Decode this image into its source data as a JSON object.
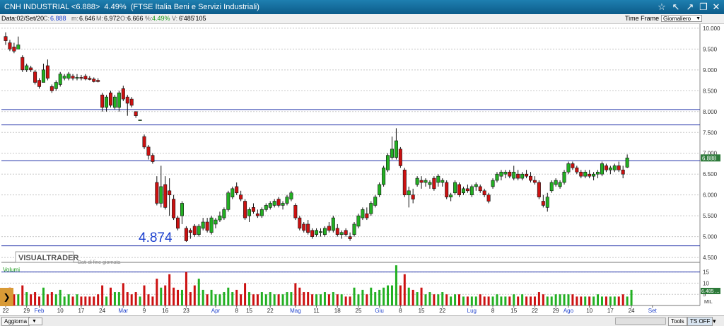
{
  "window": {
    "title": "CNH INDUSTRIAL <6.888>  4.49%  (FTSE Italia Beni e Servizi Industriali)",
    "icons": [
      "star-icon",
      "back-icon",
      "forward-icon",
      "restore-icon",
      "close-icon"
    ]
  },
  "info": {
    "date": "Data:02/Set/20",
    "close_label": "C:",
    "close": "6.888",
    "min_label": "m:",
    "min": "6.646",
    "max_label": "M:",
    "max": "6.972",
    "open_label": "O:",
    "open": "6.666",
    "pct_label": "%:",
    "pct": "4.49%",
    "vol_label": "V:",
    "vol": "6'485'105",
    "timeframe_label": "Time Frame",
    "timeframe_value": "Giornaliero"
  },
  "chart_data": {
    "type": "candlestick",
    "ylim": [
      4.4,
      10.1
    ],
    "yticks": [
      "10.000",
      "9.500",
      "9.000",
      "8.500",
      "8.000",
      "7.500",
      "7.000",
      "6.500",
      "6.000",
      "5.500",
      "5.000",
      "4.500"
    ],
    "ytick_values": [
      10.0,
      9.5,
      9.0,
      8.5,
      8.0,
      7.5,
      7.0,
      6.5,
      6.0,
      5.5,
      5.0,
      4.5
    ],
    "hlines": [
      8.05,
      7.68,
      6.82,
      4.78
    ],
    "last_price": "6.888",
    "last_price_value": 6.888,
    "low_label": "4.874",
    "low_label_value": 4.874,
    "logo": "VISUALTRADER",
    "note": "Dati di fine giornata",
    "volume_title": "Volumi",
    "volume_ylim": [
      0,
      19
    ],
    "volume_ticks": [
      "15",
      "10",
      "5"
    ],
    "volume_tick_values": [
      15,
      10,
      5
    ],
    "volume_hline": 15,
    "volume_badge": "6.485 ...",
    "volume_unit": "MIL",
    "colors": {
      "up": "#22b022",
      "down": "#cc1111",
      "hline": "#2233aa",
      "grid": "#c8c8c8"
    },
    "xticks": [
      {
        "i": 0,
        "label": "22",
        "month": false
      },
      {
        "i": 5,
        "label": "29",
        "month": false
      },
      {
        "i": 8,
        "label": "Feb",
        "month": true
      },
      {
        "i": 13,
        "label": "10",
        "month": false
      },
      {
        "i": 18,
        "label": "17",
        "month": false
      },
      {
        "i": 23,
        "label": "24",
        "month": false
      },
      {
        "i": 28,
        "label": "Mar",
        "month": true
      },
      {
        "i": 33,
        "label": "9",
        "month": false
      },
      {
        "i": 38,
        "label": "16",
        "month": false
      },
      {
        "i": 43,
        "label": "23",
        "month": false
      },
      {
        "i": 50,
        "label": "Apr",
        "month": true
      },
      {
        "i": 55,
        "label": "8",
        "month": false
      },
      {
        "i": 58,
        "label": "15",
        "month": false
      },
      {
        "i": 63,
        "label": "22",
        "month": false
      },
      {
        "i": 69,
        "label": "Mag",
        "month": true
      },
      {
        "i": 74,
        "label": "11",
        "month": false
      },
      {
        "i": 79,
        "label": "18",
        "month": false
      },
      {
        "i": 84,
        "label": "25",
        "month": false
      },
      {
        "i": 89,
        "label": "Giu",
        "month": true
      },
      {
        "i": 94,
        "label": "8",
        "month": false
      },
      {
        "i": 99,
        "label": "15",
        "month": false
      },
      {
        "i": 104,
        "label": "22",
        "month": false
      },
      {
        "i": 111,
        "label": "Lug",
        "month": true
      },
      {
        "i": 116,
        "label": "8",
        "month": false
      },
      {
        "i": 121,
        "label": "15",
        "month": false
      },
      {
        "i": 126,
        "label": "22",
        "month": false
      },
      {
        "i": 131,
        "label": "29",
        "month": false
      },
      {
        "i": 134,
        "label": "Ago",
        "month": true
      },
      {
        "i": 139,
        "label": "10",
        "month": false
      },
      {
        "i": 144,
        "label": "17",
        "month": false
      },
      {
        "i": 149,
        "label": "24",
        "month": false
      },
      {
        "i": 154,
        "label": "Set",
        "month": true
      }
    ],
    "candles": [
      [
        9.8,
        9.9,
        9.6,
        9.7
      ],
      [
        9.65,
        9.72,
        9.45,
        9.5
      ],
      [
        9.55,
        9.65,
        9.4,
        9.45
      ],
      [
        9.5,
        9.8,
        9.5,
        9.6
      ],
      [
        9.3,
        9.35,
        8.95,
        9.0
      ],
      [
        9.0,
        9.15,
        8.95,
        9.1
      ],
      [
        9.05,
        9.1,
        8.95,
        9.0
      ],
      [
        8.95,
        9.0,
        8.65,
        8.7
      ],
      [
        8.75,
        8.8,
        8.55,
        8.6
      ],
      [
        8.7,
        9.15,
        8.7,
        9.0
      ],
      [
        9.1,
        9.25,
        8.75,
        8.8
      ],
      [
        8.6,
        8.65,
        8.45,
        8.5
      ],
      [
        8.55,
        8.75,
        8.5,
        8.7
      ],
      [
        8.65,
        8.95,
        8.6,
        8.9
      ],
      [
        8.8,
        8.9,
        8.75,
        8.85
      ],
      [
        8.8,
        8.95,
        8.75,
        8.9
      ],
      [
        8.85,
        8.9,
        8.75,
        8.8
      ],
      [
        8.8,
        8.9,
        8.75,
        8.82
      ],
      [
        8.82,
        8.88,
        8.75,
        8.8
      ],
      [
        8.85,
        8.9,
        8.75,
        8.78
      ],
      [
        8.8,
        8.85,
        8.75,
        8.77
      ],
      [
        8.78,
        8.82,
        8.7,
        8.72
      ],
      [
        8.75,
        8.8,
        8.7,
        8.72
      ],
      [
        8.4,
        8.45,
        8.0,
        8.1
      ],
      [
        8.1,
        8.4,
        8.0,
        8.35
      ],
      [
        8.45,
        8.5,
        8.1,
        8.15
      ],
      [
        8.1,
        8.4,
        8.05,
        8.35
      ],
      [
        8.1,
        8.5,
        8.0,
        8.45
      ],
      [
        8.55,
        8.62,
        8.25,
        8.3
      ],
      [
        8.35,
        8.4,
        7.9,
        8.2
      ],
      [
        8.3,
        8.35,
        8.1,
        8.15
      ],
      [
        8.0,
        8.0,
        7.85,
        7.9
      ],
      [
        7.8,
        7.8,
        7.8,
        7.8
      ],
      [
        7.4,
        7.45,
        7.1,
        7.15
      ],
      [
        7.15,
        7.2,
        6.85,
        6.95
      ],
      [
        6.95,
        7.0,
        6.75,
        6.8
      ],
      [
        6.3,
        6.45,
        5.75,
        5.8
      ],
      [
        5.8,
        6.7,
        5.7,
        6.2
      ],
      [
        6.25,
        6.45,
        5.65,
        5.7
      ],
      [
        6.1,
        6.4,
        5.5,
        6.0
      ],
      [
        5.9,
        6.0,
        5.4,
        5.45
      ],
      [
        5.45,
        5.5,
        5.15,
        5.2
      ],
      [
        5.5,
        5.85,
        5.3,
        5.8
      ],
      [
        5.2,
        5.25,
        4.874,
        4.9
      ],
      [
        5.15,
        5.2,
        4.95,
        5.1
      ],
      [
        5.25,
        5.3,
        5.0,
        5.05
      ],
      [
        5.05,
        5.3,
        5.0,
        5.25
      ],
      [
        5.2,
        5.45,
        5.15,
        5.35
      ],
      [
        5.35,
        5.45,
        5.1,
        5.15
      ],
      [
        5.1,
        5.5,
        5.05,
        5.45
      ],
      [
        5.3,
        5.45,
        5.2,
        5.4
      ],
      [
        5.4,
        5.6,
        5.35,
        5.5
      ],
      [
        5.45,
        5.7,
        5.4,
        5.65
      ],
      [
        5.65,
        6.1,
        5.6,
        6.05
      ],
      [
        5.95,
        6.2,
        5.9,
        6.15
      ],
      [
        6.2,
        6.3,
        6.0,
        6.05
      ],
      [
        6.0,
        6.1,
        5.85,
        5.9
      ],
      [
        5.85,
        5.9,
        5.4,
        5.45
      ],
      [
        5.5,
        5.7,
        5.35,
        5.65
      ],
      [
        5.7,
        5.8,
        5.55,
        5.6
      ],
      [
        5.55,
        5.65,
        5.45,
        5.5
      ],
      [
        5.5,
        5.7,
        5.45,
        5.65
      ],
      [
        5.65,
        5.8,
        5.6,
        5.75
      ],
      [
        5.7,
        5.85,
        5.65,
        5.8
      ],
      [
        5.75,
        5.9,
        5.7,
        5.85
      ],
      [
        5.9,
        5.95,
        5.7,
        5.75
      ],
      [
        5.75,
        5.85,
        5.65,
        5.8
      ],
      [
        5.8,
        6.0,
        5.75,
        5.95
      ],
      [
        5.9,
        6.1,
        5.85,
        6.05
      ],
      [
        5.75,
        5.8,
        5.4,
        5.45
      ],
      [
        5.45,
        5.5,
        5.15,
        5.2
      ],
      [
        5.3,
        5.35,
        5.1,
        5.15
      ],
      [
        5.3,
        5.4,
        5.05,
        5.1
      ],
      [
        5.15,
        5.2,
        4.95,
        5.0
      ],
      [
        5.05,
        5.2,
        5.0,
        5.15
      ],
      [
        5.1,
        5.2,
        5.0,
        5.12
      ],
      [
        5.05,
        5.25,
        5.0,
        5.2
      ],
      [
        5.25,
        5.35,
        5.1,
        5.15
      ],
      [
        5.15,
        5.5,
        5.1,
        5.45
      ],
      [
        5.2,
        5.3,
        5.0,
        5.05
      ],
      [
        5.05,
        5.15,
        4.95,
        5.1
      ],
      [
        5.15,
        5.2,
        5.0,
        5.05
      ],
      [
        5.0,
        5.1,
        4.9,
        4.95
      ],
      [
        5.05,
        5.35,
        5.0,
        5.3
      ],
      [
        5.25,
        5.55,
        5.2,
        5.5
      ],
      [
        5.45,
        5.7,
        5.4,
        5.65
      ],
      [
        5.55,
        5.7,
        5.4,
        5.45
      ],
      [
        5.55,
        5.85,
        5.5,
        5.8
      ],
      [
        5.75,
        6.0,
        5.7,
        5.95
      ],
      [
        6.0,
        6.3,
        5.95,
        6.25
      ],
      [
        6.25,
        6.7,
        6.2,
        6.65
      ],
      [
        6.6,
        7.0,
        6.55,
        6.95
      ],
      [
        6.9,
        7.4,
        6.85,
        7.1
      ],
      [
        6.9,
        7.6,
        6.85,
        7.3
      ],
      [
        7.1,
        7.15,
        6.65,
        6.7
      ],
      [
        6.6,
        6.65,
        5.95,
        6.0
      ],
      [
        6.0,
        6.2,
        5.7,
        6.1
      ],
      [
        6.0,
        6.15,
        5.8,
        5.9
      ],
      [
        6.25,
        6.45,
        6.2,
        6.4
      ],
      [
        6.35,
        6.45,
        6.15,
        6.3
      ],
      [
        6.3,
        6.4,
        6.2,
        6.35
      ],
      [
        6.25,
        6.35,
        6.15,
        6.3
      ],
      [
        6.4,
        6.45,
        6.1,
        6.15
      ],
      [
        6.3,
        6.5,
        6.2,
        6.45
      ],
      [
        6.3,
        6.4,
        6.2,
        6.35
      ],
      [
        6.3,
        6.35,
        5.9,
        5.95
      ],
      [
        5.95,
        6.05,
        5.85,
        6.0
      ],
      [
        6.05,
        6.35,
        6.0,
        6.3
      ],
      [
        6.25,
        6.3,
        5.95,
        6.0
      ],
      [
        6.05,
        6.2,
        6.0,
        6.15
      ],
      [
        6.15,
        6.25,
        6.05,
        6.1
      ],
      [
        6.0,
        6.25,
        5.95,
        6.2
      ],
      [
        6.2,
        6.3,
        6.1,
        6.25
      ],
      [
        6.2,
        6.25,
        6.05,
        6.1
      ],
      [
        6.1,
        6.15,
        5.95,
        6.0
      ],
      [
        6.0,
        6.05,
        5.8,
        5.85
      ],
      [
        6.2,
        6.4,
        6.15,
        6.35
      ],
      [
        6.35,
        6.55,
        6.3,
        6.5
      ],
      [
        6.45,
        6.6,
        6.35,
        6.55
      ],
      [
        6.5,
        6.6,
        6.4,
        6.55
      ],
      [
        6.55,
        6.6,
        6.4,
        6.45
      ],
      [
        6.4,
        6.7,
        6.35,
        6.55
      ],
      [
        6.5,
        6.6,
        6.35,
        6.4
      ],
      [
        6.4,
        6.55,
        6.35,
        6.5
      ],
      [
        6.5,
        6.6,
        6.4,
        6.45
      ],
      [
        6.45,
        6.55,
        6.3,
        6.35
      ],
      [
        6.35,
        6.45,
        6.25,
        6.3
      ],
      [
        6.3,
        6.35,
        5.9,
        5.95
      ],
      [
        5.85,
        6.0,
        5.7,
        5.75
      ],
      [
        5.7,
        6.05,
        5.6,
        5.95
      ],
      [
        6.1,
        6.35,
        6.05,
        6.3
      ],
      [
        6.25,
        6.4,
        6.2,
        6.35
      ],
      [
        6.2,
        6.35,
        6.15,
        6.3
      ],
      [
        6.3,
        6.6,
        6.25,
        6.55
      ],
      [
        6.55,
        6.8,
        6.5,
        6.75
      ],
      [
        6.75,
        6.8,
        6.6,
        6.65
      ],
      [
        6.65,
        6.7,
        6.5,
        6.55
      ],
      [
        6.55,
        6.6,
        6.4,
        6.45
      ],
      [
        6.45,
        6.6,
        6.4,
        6.55
      ],
      [
        6.5,
        6.6,
        6.4,
        6.45
      ],
      [
        6.45,
        6.55,
        6.35,
        6.5
      ],
      [
        6.5,
        6.6,
        6.4,
        6.55
      ],
      [
        6.5,
        6.8,
        6.45,
        6.75
      ],
      [
        6.7,
        6.75,
        6.55,
        6.6
      ],
      [
        6.6,
        6.7,
        6.5,
        6.65
      ],
      [
        6.6,
        6.75,
        6.55,
        6.7
      ],
      [
        6.7,
        6.8,
        6.55,
        6.6
      ],
      [
        6.6,
        6.7,
        6.4,
        6.5
      ],
      [
        6.666,
        6.972,
        6.646,
        6.888
      ]
    ],
    "volumes": [
      6,
      8,
      5,
      5,
      9,
      6,
      5,
      6,
      4,
      8,
      5,
      6,
      5,
      7,
      4,
      5,
      4,
      5,
      4,
      4,
      4,
      4,
      5,
      9,
      4,
      8,
      6,
      6,
      10,
      6,
      5,
      6,
      4,
      9,
      5,
      4,
      12,
      8,
      9,
      14,
      8,
      7,
      7,
      15,
      6,
      9,
      12,
      7,
      5,
      7,
      5,
      5,
      6,
      8,
      6,
      7,
      5,
      10,
      6,
      5,
      5,
      6,
      5,
      6,
      5,
      5,
      5,
      6,
      6,
      10,
      8,
      6,
      6,
      5,
      5,
      5,
      6,
      5,
      6,
      5,
      5,
      4,
      4,
      8,
      5,
      7,
      5,
      8,
      6,
      7,
      8,
      9,
      9,
      18,
      9,
      14,
      8,
      7,
      6,
      8,
      5,
      6,
      5,
      5,
      6,
      5,
      4,
      5,
      5,
      4,
      4,
      4,
      4,
      5,
      4,
      4,
      4,
      5,
      4,
      4,
      4,
      5,
      4,
      5,
      4,
      4,
      4,
      6,
      5,
      4,
      4,
      5,
      5,
      5,
      5,
      5,
      4,
      4,
      4,
      4,
      4,
      5,
      4,
      4,
      4,
      4,
      4,
      5,
      4,
      7
    ]
  },
  "bottom": {
    "aggiorna": "Aggiorna",
    "tools": "Tools",
    "ts_off": "TS OFF"
  }
}
